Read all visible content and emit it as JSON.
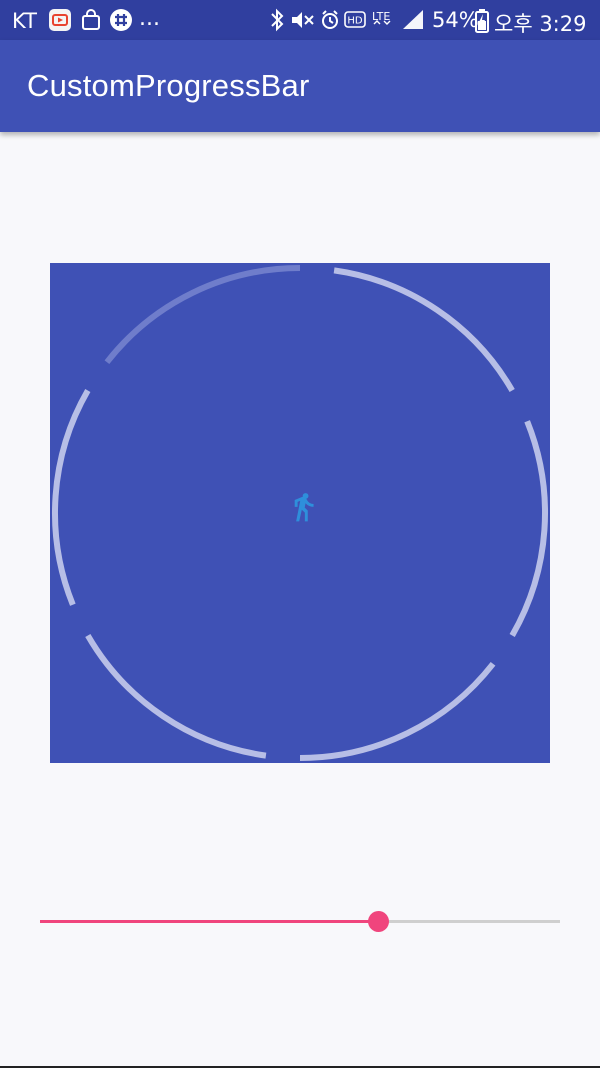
{
  "status_bar": {
    "carrier": "KT",
    "notification_icons": [
      "tv-app-icon",
      "shopping-bag-icon",
      "slack-icon"
    ],
    "overflow": "...",
    "system_icons": [
      "bluetooth-icon",
      "mute-icon",
      "alarm-icon",
      "hd-voice-icon",
      "lte-icon",
      "signal-icon",
      "battery-icon"
    ],
    "lte_label": "LTE",
    "hd_label": "HD",
    "battery_percent": "54%",
    "time": "오후 3:29"
  },
  "app_bar": {
    "title": "CustomProgressBar"
  },
  "progress": {
    "center_icon": "walk-icon",
    "segment_count": 6,
    "dim_segments": 1,
    "colors": {
      "background": "#3f51b5",
      "segment": "#b7bee6",
      "segment_dim": "#6f7dcb",
      "icon": "#2e8fdb"
    }
  },
  "seekbar": {
    "value": 0.65,
    "active_color": "#f0457d",
    "inactive_color": "#cfcfcf"
  }
}
